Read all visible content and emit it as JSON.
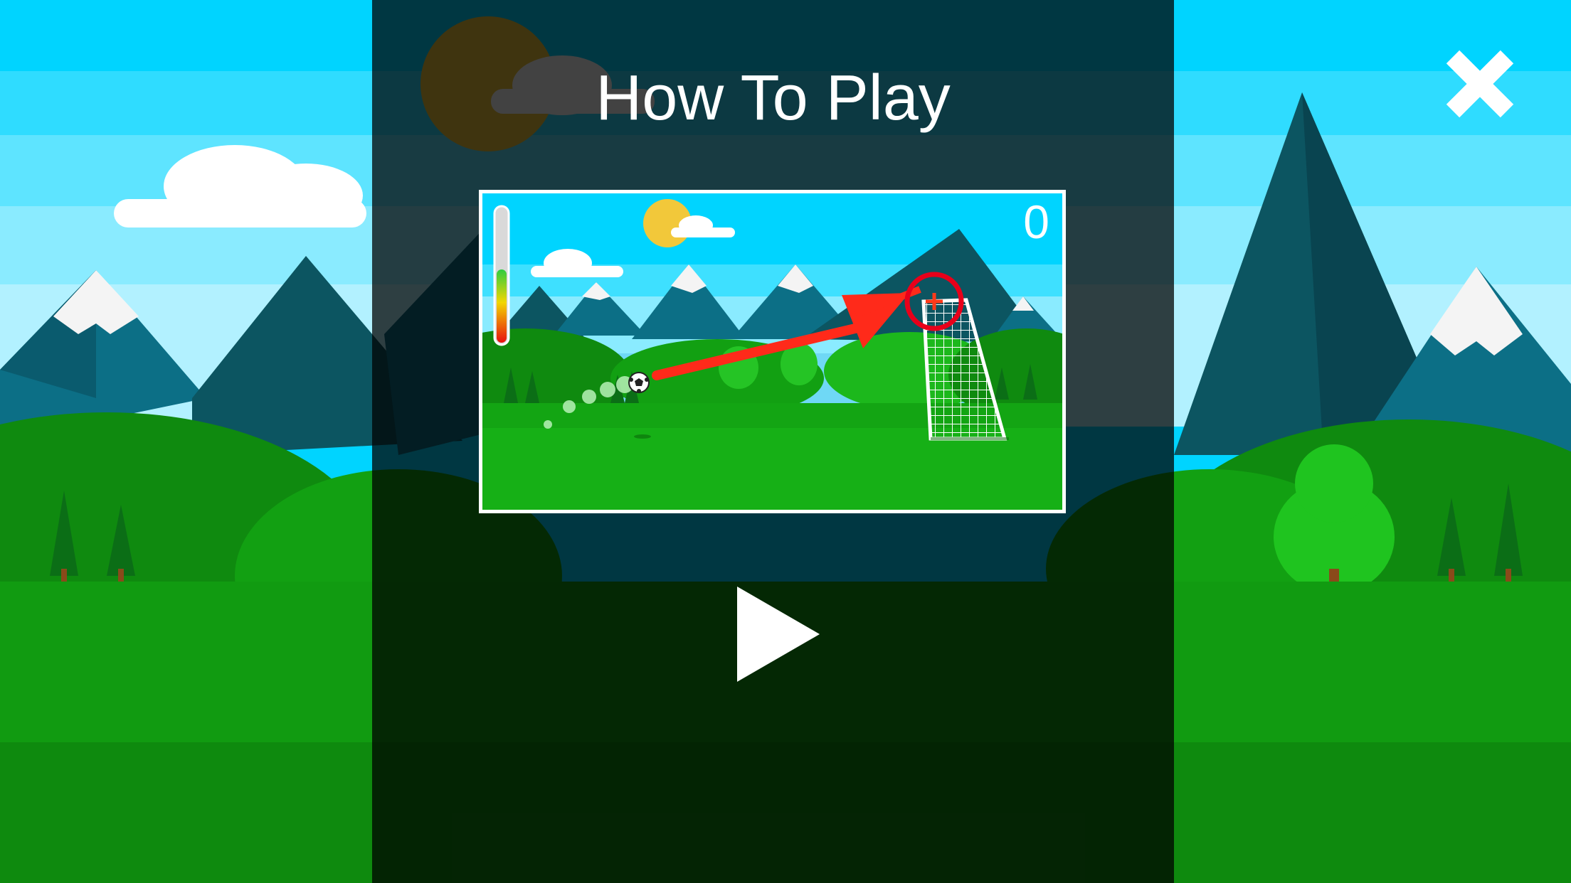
{
  "title": "How To Play",
  "close_icon": "close-icon",
  "play_icon": "play-icon",
  "tutorial": {
    "score": "0",
    "power_meter_level": 0.55,
    "instruction_icons": [
      "soccer-ball-icon",
      "aim-arrow-icon",
      "target-reticle-icon",
      "goal-net-icon"
    ]
  },
  "colors": {
    "sky": "#00d4ff",
    "overlay": "#000000",
    "grass": "#119b11",
    "mountain_dark": "#0c5561",
    "snow": "#f4f4f4",
    "aim_arrow": "#ff2a1a",
    "reticle": "#e8001a",
    "text": "#ffffff"
  }
}
